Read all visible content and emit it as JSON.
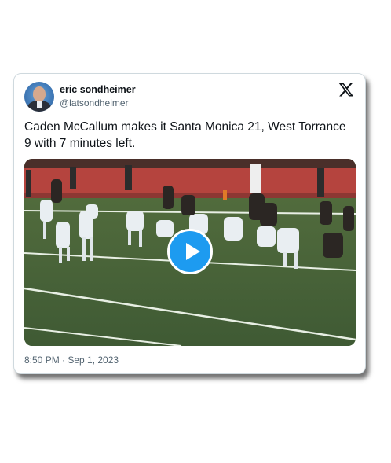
{
  "author": {
    "name": "eric sondheimer",
    "handle": "@latsondheimer"
  },
  "tweet": {
    "text": "Caden McCallum makes it Santa Monica 21, West Torrance 9 with 7 minutes left.",
    "timestamp": "8:50 PM · Sep 1, 2023"
  },
  "icons": {
    "platform": "x-logo-icon",
    "media_action": "play-icon"
  },
  "colors": {
    "accent": "#1d9bf0",
    "text": "#0f1419",
    "muted": "#536471"
  }
}
